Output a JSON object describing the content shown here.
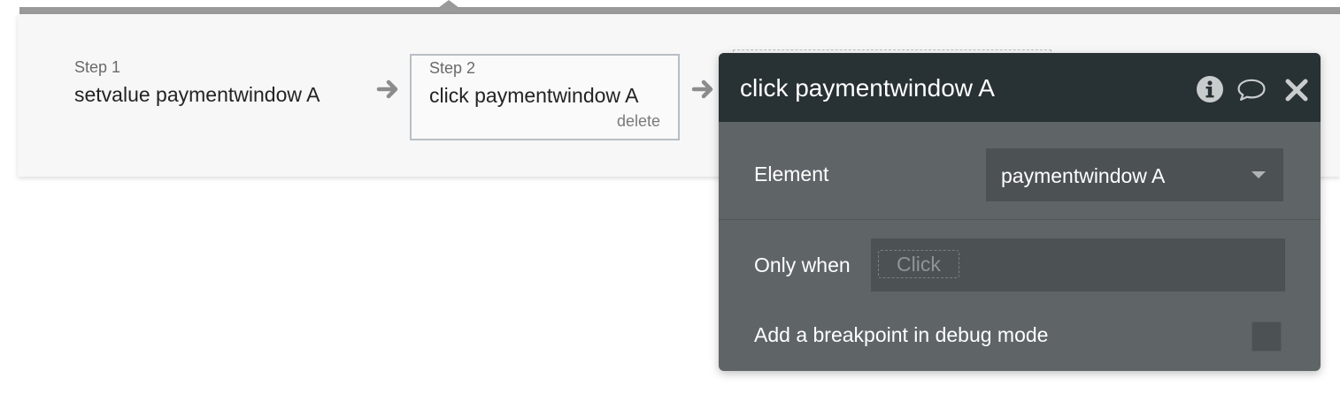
{
  "workflow": {
    "steps": [
      {
        "label": "Step 1",
        "title": "setvalue paymentwindow A"
      },
      {
        "label": "Step 2",
        "title": "click paymentwindow A",
        "delete_label": "delete"
      }
    ]
  },
  "editor": {
    "title": "click paymentwindow A",
    "icons": [
      "info-icon",
      "comment-icon",
      "close-icon"
    ],
    "element": {
      "label": "Element",
      "value": "paymentwindow A"
    },
    "only_when": {
      "label": "Only when",
      "placeholder": "Click"
    },
    "breakpoint": {
      "label": "Add a breakpoint in debug mode",
      "checked": false
    }
  },
  "colors": {
    "panel_bg": "#f7f7f7",
    "editor_header": "#283134",
    "editor_body": "#5f6467",
    "field_bg": "#4c5154"
  }
}
